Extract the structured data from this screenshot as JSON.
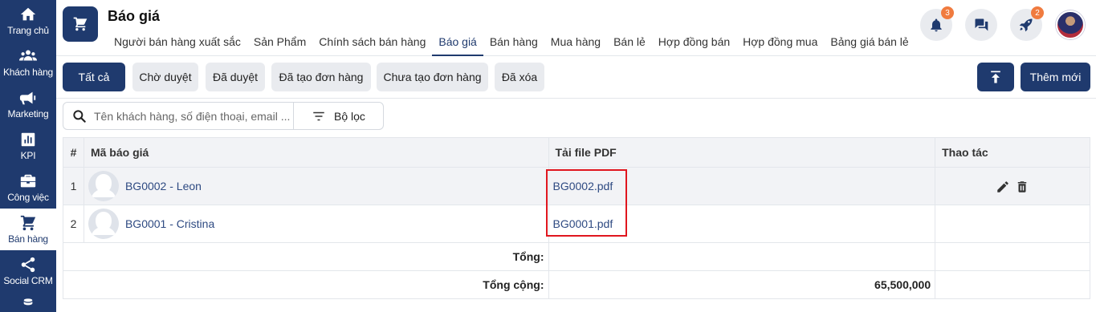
{
  "sidebar": {
    "items": [
      {
        "label": "Trang chủ",
        "icon": "home-icon"
      },
      {
        "label": "Khách hàng",
        "icon": "customers-icon"
      },
      {
        "label": "Marketing",
        "icon": "megaphone-icon"
      },
      {
        "label": "KPI",
        "icon": "bar-chart-icon"
      },
      {
        "label": "Công việc",
        "icon": "briefcase-icon"
      },
      {
        "label": "Bán hàng",
        "icon": "cart-icon"
      },
      {
        "label": "Social CRM",
        "icon": "share-icon"
      }
    ]
  },
  "header": {
    "title": "Báo giá",
    "tabs": [
      "Người bán hàng xuất sắc",
      "Sản Phẩm",
      "Chính sách bán hàng",
      "Báo giá",
      "Bán hàng",
      "Mua hàng",
      "Bán lẻ",
      "Hợp đồng bán",
      "Hợp đồng mua",
      "Bảng giá bán lẻ"
    ],
    "notifications_badge": "3",
    "rocket_badge": "2"
  },
  "filters": {
    "chips": [
      "Tất cả",
      "Chờ duyệt",
      "Đã duyệt",
      "Đã tạo đơn hàng",
      "Chưa tạo đơn hàng",
      "Đã xóa"
    ],
    "add_label": "Thêm mới"
  },
  "search": {
    "placeholder": "Tên khách hàng, số điện thoại, email ...",
    "filter_label": "Bộ lọc"
  },
  "table": {
    "headers": [
      "#",
      "Mã báo giá",
      "Tải file PDF",
      "Thao tác"
    ],
    "rows": [
      {
        "index": "1",
        "code": "BG0002 - Leon",
        "pdf": "BG0002.pdf"
      },
      {
        "index": "2",
        "code": "BG0001 - Cristina",
        "pdf": "BG0001.pdf"
      }
    ],
    "total_label": "Tổng:",
    "grand_total_label": "Tổng cộng:",
    "grand_total_value": "65,500,000"
  },
  "colors": {
    "primary": "#1f3a6e",
    "badge": "#f07b3f",
    "highlight": "#e0161e"
  }
}
